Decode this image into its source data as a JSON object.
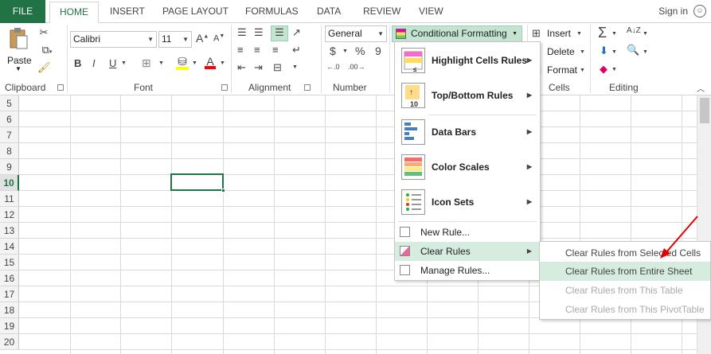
{
  "tabs": {
    "file": "FILE",
    "home": "HOME",
    "insert": "INSERT",
    "page_layout": "PAGE LAYOUT",
    "formulas": "FORMULAS",
    "data": "DATA",
    "review": "REVIEW",
    "view": "VIEW"
  },
  "account": {
    "sign_in": "Sign in"
  },
  "ribbon": {
    "clipboard": {
      "paste": "Paste",
      "label": "Clipboard"
    },
    "font": {
      "name": "Calibri",
      "size": "11",
      "grow": "A",
      "shrink": "A",
      "bold": "B",
      "italic": "I",
      "underline": "U",
      "label": "Font",
      "fill_color": "#ffff00",
      "font_color": "#ff0000"
    },
    "alignment": {
      "label": "Alignment"
    },
    "number": {
      "format": "General",
      "currency": "$",
      "percent": "%",
      "comma": "9",
      "label": "Number"
    },
    "styles": {
      "conditional_formatting": "Conditional Formatting"
    },
    "cells": {
      "insert": "Insert",
      "delete": "Delete",
      "format": "Format",
      "label": "Cells"
    },
    "editing": {
      "label": "Editing"
    }
  },
  "rows": [
    "5",
    "6",
    "7",
    "8",
    "9",
    "10",
    "11",
    "12",
    "13",
    "14",
    "15",
    "16",
    "17",
    "18",
    "19",
    "20"
  ],
  "selected_row": "10",
  "cf_menu": {
    "highlight": "Highlight Cells Rules",
    "topbottom": "Top/Bottom Rules",
    "databars": "Data Bars",
    "colorscales": "Color Scales",
    "iconsets": "Icon Sets",
    "newrule": "New Rule...",
    "clearrules": "Clear Rules",
    "managerules": "Manage Rules..."
  },
  "clear_submenu": {
    "selected": "Clear Rules from Selected Cells",
    "entire": "Clear Rules from Entire Sheet",
    "table": "Clear Rules from This Table",
    "pivot": "Clear Rules from This PivotTable"
  },
  "colors": {
    "accent": "#217346",
    "highlight": "#d5ecde",
    "annotation_arrow": "#e00000"
  }
}
